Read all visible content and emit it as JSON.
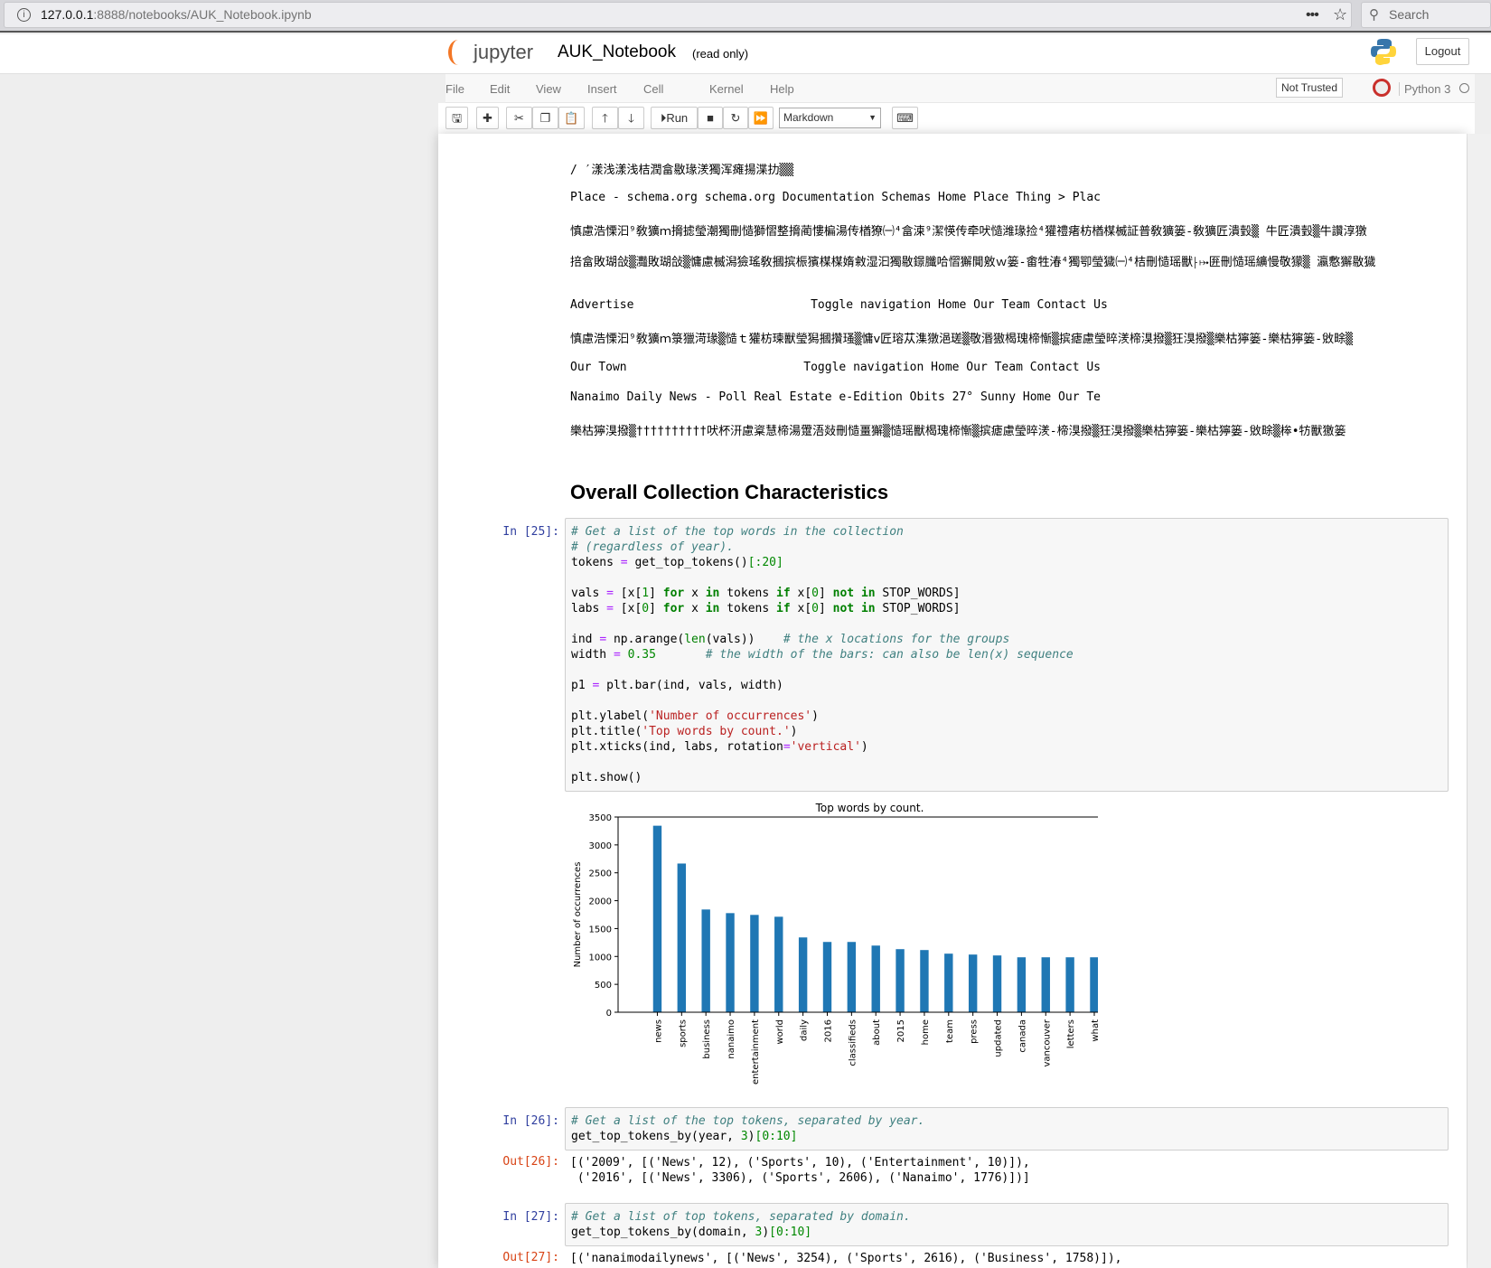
{
  "browser": {
    "url_host": "127.0.0.1",
    "url_rest": ":8888/notebooks/AUK_Notebook.ipynb",
    "search_placeholder": "Search"
  },
  "header": {
    "logo_text": "jupyter",
    "title": "AUK_Notebook",
    "readonly": "(read only)",
    "logout": "Logout"
  },
  "menu": {
    "items": [
      "File",
      "Edit",
      "View",
      "Insert",
      "Cell",
      "Kernel",
      "Help"
    ],
    "not_trusted": "Not Trusted",
    "kernel": "Python 3"
  },
  "toolbar": {
    "run": "Run",
    "cell_type": "Markdown"
  },
  "text_lines": [
    "/ ′漾浅漾浅桔潤畣敭瑑湵獨浑瘫揚渫扐▒▒",
    "Place - schema.org schema.org Documentation Schemas Home Place Thing > Plac",
    "慎慮浩慄汩⁹敎獷ｍ搚摅瑩潮獨刪慥獅慴整搚蔺慺楄湯传楢獠㈠⁴畣湅⁹潔愥传牵吠慥潍瑑捡⁴獾禮瘏枋楢楳楲証普敎獷篓‑敎獷匠潰瑴▒ 牛匠潰瑴▒牛讚淳獤",
    "掊畣敗瑚敆▒灩敗瑚敆▒慵慮楲潟獫瑤敎摑摈桭獱楳楳媠敹湿汩獨敭鐛䑎哈慴獬閴敫ｗ篓‑畬牲湷⁴獨卾瑩獩㈠⁴桔刪慥瑶獸⸠⤠匥刪慥瑶纊慢敬獴▒ 瀛懯獬敭獩",
    "Advertise                         Toggle navigation Home Our Team Contact Us",
    "慎慮浩慄汩⁹敎獷ｍ箓獵渮瑑▒慥ｔ獾枋瑓獸瑩獡摑攢瑵▒慵ⅴ匠瑢苁潗獤浥瑳▒敬湣獓楬瑰楴慚▒摈瘧慮瑩晬湵楴湨撥▒狂湨撥▒樂枯獰篓‑樂枯獰篓‑敓畭▒",
    "Our Town                         Toggle navigation Home Our Team Contact Us",
    "Nanaimo Daily News - Poll Real Estate e-Edition Obits 27° Sunny Home Our Te",
    "樂枯獰湨撥▒††††††††††吠杯汧慮楶慧楴湯䠠浯敥刪慥畺獬▒慥瑶獸楬瑰楴慚▒摈瘧慮瑩晬湵‑楴湨撥▒狂湨撥▒樂枯獰篓‑樂枯獰篓‑敓畭▒桳•牥獸獥篓"
  ],
  "heading": "Overall Collection Characteristics",
  "cells": [
    {
      "prompt": "In [25]:",
      "code": [
        [
          [
            "c",
            "# Get a list of the top words in the collection"
          ]
        ],
        [
          [
            "c",
            "# (regardless of year)."
          ]
        ],
        [
          [
            "",
            "tokens "
          ],
          [
            "o",
            "="
          ],
          [
            "",
            " get_top_tokens()"
          ],
          [
            "n",
            "[:20]"
          ]
        ],
        [],
        [
          [
            "",
            "vals "
          ],
          [
            "o",
            "="
          ],
          [
            "",
            " [x["
          ],
          [
            "n",
            "1"
          ],
          [
            "",
            "] "
          ],
          [
            "k",
            "for"
          ],
          [
            "",
            " x "
          ],
          [
            "k",
            "in"
          ],
          [
            "",
            " tokens "
          ],
          [
            "k",
            "if"
          ],
          [
            "",
            " x["
          ],
          [
            "n",
            "0"
          ],
          [
            "",
            "] "
          ],
          [
            "k",
            "not in"
          ],
          [
            "",
            " STOP_WORDS]"
          ]
        ],
        [
          [
            "",
            "labs "
          ],
          [
            "o",
            "="
          ],
          [
            "",
            " [x["
          ],
          [
            "n",
            "0"
          ],
          [
            "",
            "] "
          ],
          [
            "k",
            "for"
          ],
          [
            "",
            " x "
          ],
          [
            "k",
            "in"
          ],
          [
            "",
            " tokens "
          ],
          [
            "k",
            "if"
          ],
          [
            "",
            " x["
          ],
          [
            "n",
            "0"
          ],
          [
            "",
            "] "
          ],
          [
            "k",
            "not in"
          ],
          [
            "",
            " STOP_WORDS]"
          ]
        ],
        [],
        [
          [
            "",
            "ind "
          ],
          [
            "o",
            "="
          ],
          [
            "",
            " np.arange("
          ],
          [
            "b",
            "len"
          ],
          [
            "",
            "(vals))    "
          ],
          [
            "c",
            "# the x locations for the groups"
          ]
        ],
        [
          [
            "",
            "width "
          ],
          [
            "o",
            "="
          ],
          [
            "n",
            " 0.35"
          ],
          [
            "",
            "       "
          ],
          [
            "c",
            "# the width of the bars: can also be len(x) sequence"
          ]
        ],
        [],
        [
          [
            "",
            "p1 "
          ],
          [
            "o",
            "="
          ],
          [
            "",
            " plt.bar(ind, vals, width)"
          ]
        ],
        [],
        [
          [
            "",
            "plt.ylabel("
          ],
          [
            "s",
            "'Number of occurrences'"
          ],
          [
            "",
            ")"
          ]
        ],
        [
          [
            "",
            "plt.title("
          ],
          [
            "s",
            "'Top words by count.'"
          ],
          [
            "",
            ")"
          ]
        ],
        [
          [
            "",
            "plt.xticks(ind, labs, rotation"
          ],
          [
            "o",
            "="
          ],
          [
            "s",
            "'vertical'"
          ],
          [
            "",
            ")"
          ]
        ],
        [],
        [
          [
            "",
            "plt.show()"
          ]
        ]
      ]
    },
    {
      "prompt": "In [26]:",
      "code": [
        [
          [
            "c",
            "# Get a list of the top tokens, separated by year."
          ]
        ],
        [
          [
            "",
            "get_top_tokens_by(year, "
          ],
          [
            "n",
            "3"
          ],
          [
            "",
            ")"
          ],
          [
            "n",
            "[0:10]"
          ]
        ]
      ],
      "out_prompt": "Out[26]:",
      "output": [
        "[('2009', [('News', 12), ('Sports', 10), ('Entertainment', 10)]),",
        " ('2016', [('News', 3306), ('Sports', 2606), ('Nanaimo', 1776)])]"
      ]
    },
    {
      "prompt": "In [27]:",
      "code": [
        [
          [
            "c",
            "# Get a list of top tokens, separated by domain."
          ]
        ],
        [
          [
            "",
            "get_top_tokens_by(domain, "
          ],
          [
            "n",
            "3"
          ],
          [
            "",
            ")"
          ],
          [
            "n",
            "[0:10]"
          ]
        ]
      ],
      "out_prompt": "Out[27]:",
      "output": [
        "[('nanaimodailynews', [('News', 3254), ('Sports', 2616), ('Business', 1758)]),"
      ]
    }
  ],
  "chart_data": {
    "type": "bar",
    "title": "Top words by count.",
    "xlabel": "",
    "ylabel": "Number of occurrences",
    "categories": [
      "news",
      "sports",
      "business",
      "nanaimo",
      "entertainment",
      "world",
      "daily",
      "2016",
      "classifieds",
      "about",
      "2015",
      "home",
      "team",
      "press",
      "updated",
      "canada",
      "vancouver",
      "letters",
      "what"
    ],
    "values": [
      3344,
      2666,
      1842,
      1777,
      1745,
      1712,
      1341,
      1260,
      1260,
      1195,
      1131,
      1115,
      1050,
      1034,
      1018,
      985,
      985,
      985,
      985
    ],
    "ylim": [
      0,
      3500
    ],
    "yticks": [
      0,
      500,
      1000,
      1500,
      2000,
      2500,
      3000,
      3500
    ],
    "bar_color": "#1f77b4",
    "grid": false,
    "xtick_rotation": "vertical"
  }
}
